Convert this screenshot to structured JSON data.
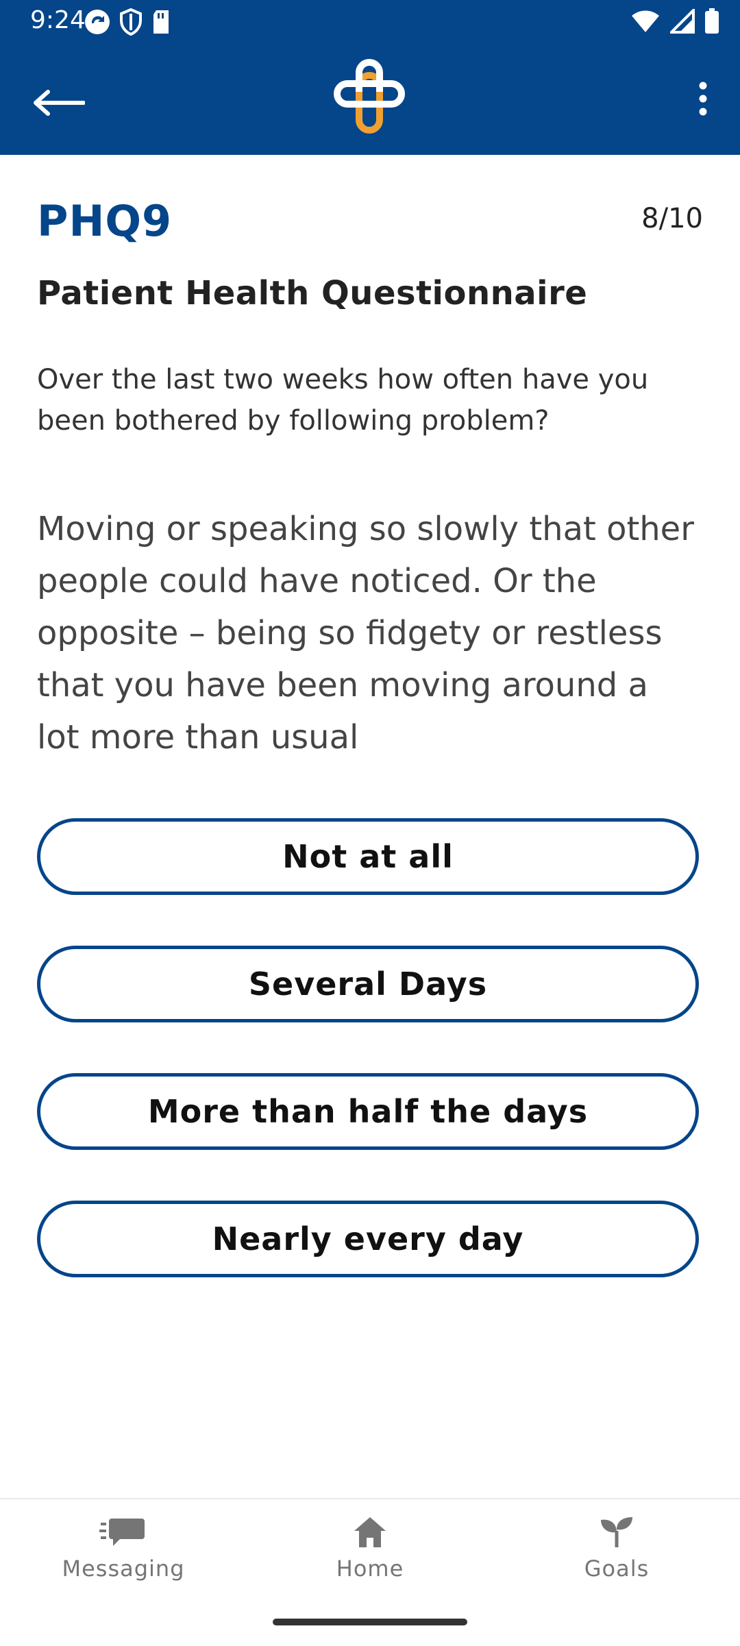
{
  "status_bar": {
    "time": "9:24"
  },
  "header": {
    "back_icon": "arrow-left-icon",
    "logo_icon": "cross-logo-icon",
    "more_icon": "more-vertical-icon"
  },
  "questionnaire": {
    "short_title": "PHQ9",
    "progress": "8/10",
    "title": "Patient Health Questionnaire",
    "instruction": "Over the last two weeks how often have you been bothered by following problem?",
    "question": "Moving or speaking so slowly that other people could have noticed. Or the opposite – being so fidgety or restless that you have been moving around a lot more than usual",
    "options": [
      {
        "label": "Not at all"
      },
      {
        "label": "Several Days"
      },
      {
        "label": "More than half the days"
      },
      {
        "label": "Nearly every day"
      }
    ]
  },
  "bottom_nav": {
    "items": [
      {
        "label": "Messaging",
        "icon": "chat-icon"
      },
      {
        "label": "Home",
        "icon": "home-icon"
      },
      {
        "label": "Goals",
        "icon": "sprout-icon"
      }
    ]
  },
  "colors": {
    "primary": "#05458a",
    "accent": "#f0a030"
  }
}
